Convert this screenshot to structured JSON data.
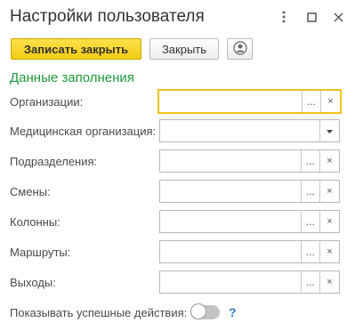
{
  "window": {
    "title": "Настройки пользователя",
    "controls": {
      "more_icon": "more-vertical-icon",
      "maximize_icon": "maximize-icon",
      "close_icon": "close-icon"
    }
  },
  "toolbar": {
    "save_close_label": "Записать закрыть",
    "close_label": "Закрыть",
    "user_icon": "user-icon"
  },
  "section": {
    "title": "Данные заполнения"
  },
  "fields": [
    {
      "label": "Организации:",
      "value": "",
      "kind": "select-clear",
      "focused": true
    },
    {
      "label": "Медицинская организация:",
      "value": "",
      "kind": "dropdown",
      "focused": false
    },
    {
      "label": "Подразделения:",
      "value": "",
      "kind": "select-clear",
      "focused": false
    },
    {
      "label": "Смены:",
      "value": "",
      "kind": "select-clear",
      "focused": false
    },
    {
      "label": "Колонны:",
      "value": "",
      "kind": "select-clear",
      "focused": false
    },
    {
      "label": "Маршруты:",
      "value": "",
      "kind": "select-clear",
      "focused": false
    },
    {
      "label": "Выходы:",
      "value": "",
      "kind": "select-clear",
      "focused": false
    }
  ],
  "field_buttons": {
    "select": "...",
    "clear": "×"
  },
  "toggle": {
    "label": "Показывать успешные действия:",
    "enabled": false,
    "help": "?"
  },
  "colors": {
    "accent": "#f4cc16",
    "section_title": "#1f9a3c",
    "help": "#2a7fd4",
    "focus_border": "#f0c419"
  }
}
